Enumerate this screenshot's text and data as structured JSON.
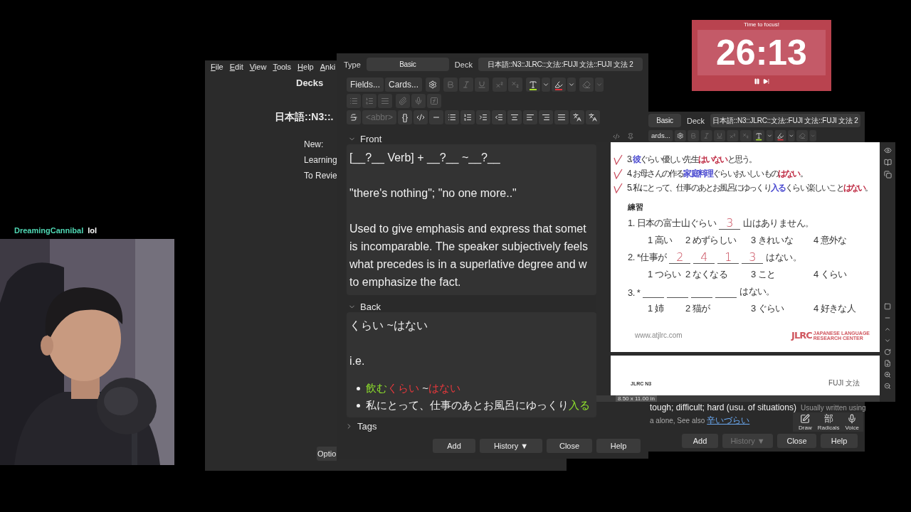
{
  "chat": {
    "user": "DreamingCannibal",
    "message": "lol"
  },
  "main_window": {
    "menu": [
      "File",
      "Edit",
      "View",
      "Tools",
      "Help",
      "Anki"
    ],
    "title": "Decks",
    "deck": "日本語::N3::.",
    "stats": [
      "New:",
      "Learning",
      "To Revie"
    ],
    "button": "Optio"
  },
  "editor": {
    "type_label": "Type",
    "type": "Basic",
    "deck_label": "Deck",
    "deck": "日本語::N3::JLRC::文法::FUJI 文法::FUJI 文法 2",
    "toolbar": [
      [
        [
          {
            "kind": "button",
            "label": "Fields...",
            "disabled": false
          },
          {
            "kind": "button",
            "label": "Cards...",
            "disabled": false
          }
        ],
        [
          {
            "kind": "settings",
            "disabled": false
          }
        ],
        [
          {
            "kind": "bold",
            "disabled": true
          },
          {
            "kind": "italic",
            "disabled": true
          },
          {
            "kind": "underline",
            "disabled": true
          }
        ],
        [
          {
            "kind": "superscript",
            "disabled": true
          },
          {
            "kind": "subscript",
            "disabled": true
          }
        ],
        [
          {
            "kind": "text-color",
            "disabled": false,
            "color": "#a8e02a"
          },
          {
            "kind": "caret",
            "disabled": false
          },
          {
            "kind": "highlight",
            "disabled": false,
            "color": "#e0323c"
          },
          {
            "kind": "caret",
            "disabled": false
          }
        ],
        [
          {
            "kind": "eraser",
            "disabled": true
          },
          {
            "kind": "caret",
            "disabled": true
          }
        ]
      ],
      [
        [
          {
            "kind": "bullet-list",
            "disabled": true
          },
          {
            "kind": "numbered-list",
            "disabled": true
          },
          {
            "kind": "paragraph",
            "disabled": true
          }
        ],
        [
          {
            "kind": "attachment",
            "disabled": true
          },
          {
            "kind": "microphone",
            "disabled": true
          },
          {
            "kind": "function",
            "disabled": true
          }
        ]
      ],
      [
        [
          {
            "kind": "strikethrough",
            "disabled": false
          },
          {
            "kind": "button",
            "label": "<abbr>",
            "disabled": true
          },
          {
            "kind": "button",
            "label": "{}",
            "disabled": false
          },
          {
            "kind": "code",
            "disabled": false
          },
          {
            "kind": "rule",
            "disabled": false
          },
          {
            "kind": "bullet-list",
            "disabled": false
          },
          {
            "kind": "numbered-list",
            "disabled": false
          },
          {
            "kind": "indent",
            "disabled": false
          },
          {
            "kind": "outdent",
            "disabled": false
          },
          {
            "kind": "align-center",
            "disabled": false
          },
          {
            "kind": "align-left",
            "disabled": false
          },
          {
            "kind": "align-right",
            "disabled": false
          },
          {
            "kind": "align-justify",
            "disabled": false
          },
          {
            "kind": "furigana",
            "disabled": false
          },
          {
            "kind": "furigana",
            "disabled": false
          }
        ]
      ]
    ],
    "fields": [
      {
        "name": "Front",
        "expanded": true,
        "blocks": [
          {
            "kind": "line",
            "segments": [
              {
                "text": "[__?__ Verb] + __?__ ~__?__"
              }
            ]
          },
          {
            "kind": "line",
            "segments": [
              {
                "text": "\"there's nothing\"; \"no one more..\""
              }
            ]
          },
          {
            "kind": "paragraph",
            "lines": [
              "Used to give emphasis and express that somet",
              "is incomparable. The speaker subjectively feels",
              "what precedes is in a superlative degree and w",
              "to emphasize the fact."
            ]
          }
        ]
      },
      {
        "name": "Back",
        "expanded": true,
        "blocks": [
          {
            "kind": "line",
            "segments": [
              {
                "text": "くらい ~はない"
              }
            ]
          },
          {
            "kind": "line",
            "segments": [
              {
                "text": "i.e."
              }
            ]
          },
          {
            "kind": "bullets",
            "items": [
              {
                "segments": [
                  {
                    "text": "飲む",
                    "color": "#8ee02c"
                  },
                  {
                    "text": "くらい",
                    "color": "#e8383c"
                  },
                  {
                    "text": " ~"
                  },
                  {
                    "text": "はない",
                    "color": "#e8383c"
                  }
                ]
              },
              {
                "segments": [
                  {
                    "text": "私にとって、仕事のあとお風呂にゆっくり"
                  },
                  {
                    "text": "入る",
                    "color": "#8ee02c"
                  }
                ]
              }
            ]
          }
        ]
      }
    ],
    "tags": {
      "name": "Tags",
      "expanded": false
    },
    "buttons": [
      {
        "label": "Add",
        "disabled": false
      },
      {
        "label": "History ▼",
        "disabled": false
      },
      {
        "label": "Close",
        "disabled": false
      },
      {
        "label": "Help",
        "disabled": false
      }
    ]
  },
  "second_window": {
    "type": "Basic",
    "deck_label": "Deck",
    "deck": "日本語::N3::JLRC::文法::FUJI 文法::FUJI 文法 2",
    "toolbar": [
      {
        "kind": "button",
        "label": "ards...",
        "disabled": false
      },
      {
        "kind": "settings",
        "disabled": false
      },
      {
        "kind": "bold",
        "disabled": true
      },
      {
        "kind": "italic",
        "disabled": true
      },
      {
        "kind": "underline",
        "disabled": true
      },
      {
        "kind": "superscript",
        "disabled": true
      },
      {
        "kind": "subscript",
        "disabled": true
      },
      {
        "kind": "text-color",
        "disabled": false,
        "color": "#a8e02a"
      },
      {
        "kind": "caret",
        "disabled": false
      },
      {
        "kind": "highlight",
        "disabled": false,
        "color": "#e0323c"
      },
      {
        "kind": "caret",
        "disabled": false
      },
      {
        "kind": "eraser",
        "disabled": true
      },
      {
        "kind": "caret",
        "disabled": true
      }
    ],
    "definition": "tough; difficult; hard (usu. of situations)",
    "note": "Usually written using",
    "see_also": "a alone, See also",
    "see_also_link": "辛いづらい",
    "input_tools": [
      {
        "kind": "draw",
        "label": "Draw"
      },
      {
        "kind": "radicals",
        "glyph": "部",
        "label": "Radicals"
      },
      {
        "kind": "voice",
        "label": "Voice"
      }
    ],
    "buttons": [
      {
        "label": "Add",
        "disabled": false
      },
      {
        "label": "History ▼",
        "disabled": true
      },
      {
        "label": "Close",
        "disabled": false
      },
      {
        "label": "Help",
        "disabled": false
      }
    ]
  },
  "pdf": {
    "examples": [
      {
        "marked": true,
        "segments": [
          {
            "text": "3. "
          },
          {
            "text": "彼",
            "color": "#4a4ad0"
          },
          {
            "text": "ぐらい優しい先生"
          },
          {
            "text": "はいない",
            "color": "#c03048"
          },
          {
            "text": "と思う。"
          }
        ]
      },
      {
        "marked": true,
        "segments": [
          {
            "text": "4. お母さんの作る"
          },
          {
            "text": "家庭料理",
            "color": "#4a4ad0"
          },
          {
            "text": "ぐらいおいしいもの"
          },
          {
            "text": "はない",
            "color": "#c03048"
          },
          {
            "text": "。"
          }
        ]
      },
      {
        "marked": true,
        "segments": [
          {
            "text": "5. 私にとって、仕事のあとお風呂にゆっくり"
          },
          {
            "text": "入る",
            "color": "#4a4ad0"
          },
          {
            "text": "くらい楽しいこと"
          },
          {
            "text": "はない",
            "color": "#c03048"
          },
          {
            "text": "。"
          }
        ]
      }
    ],
    "practice_title": "練習",
    "questions": [
      {
        "parts": [
          {
            "kind": "text",
            "text": "1. 日本の富士山ぐらい"
          },
          {
            "kind": "blank",
            "answer": "3"
          },
          {
            "kind": "text",
            "text": "山はありません。"
          }
        ],
        "options": [
          "1 高い",
          "2 めずらしい",
          "3 きれいな",
          "4 意外な"
        ]
      },
      {
        "parts": [
          {
            "kind": "text",
            "text": "2. *仕事が"
          },
          {
            "kind": "blank",
            "answer": "2"
          },
          {
            "kind": "blank",
            "answer": "4"
          },
          {
            "kind": "blank",
            "answer": "1"
          },
          {
            "kind": "blank",
            "answer": "3"
          },
          {
            "kind": "text",
            "text": "はない。"
          }
        ],
        "options": [
          "1 つらい",
          "2 なくなる",
          "3 こと",
          "4 くらい"
        ]
      },
      {
        "parts": [
          {
            "kind": "text",
            "text": "3. *"
          },
          {
            "kind": "blank"
          },
          {
            "kind": "blank"
          },
          {
            "kind": "blank"
          },
          {
            "kind": "blank"
          },
          {
            "kind": "text",
            "text": "はない。"
          }
        ],
        "options": [
          "1 姉",
          "2 猫が",
          "3 ぐらい",
          "4 好きな人"
        ]
      }
    ],
    "site": "www.atjlrc.com",
    "logo": "JLRC",
    "logo_lines": [
      "JAPANESE LANGUAGE",
      "RESEARCH CENTER"
    ],
    "page2_left": "JLRC N3",
    "page2_right": "FUJI 文法",
    "page_size": "8.50 x 11.00 in"
  },
  "timer": {
    "label": "Time to focus!",
    "time": "26:13"
  }
}
